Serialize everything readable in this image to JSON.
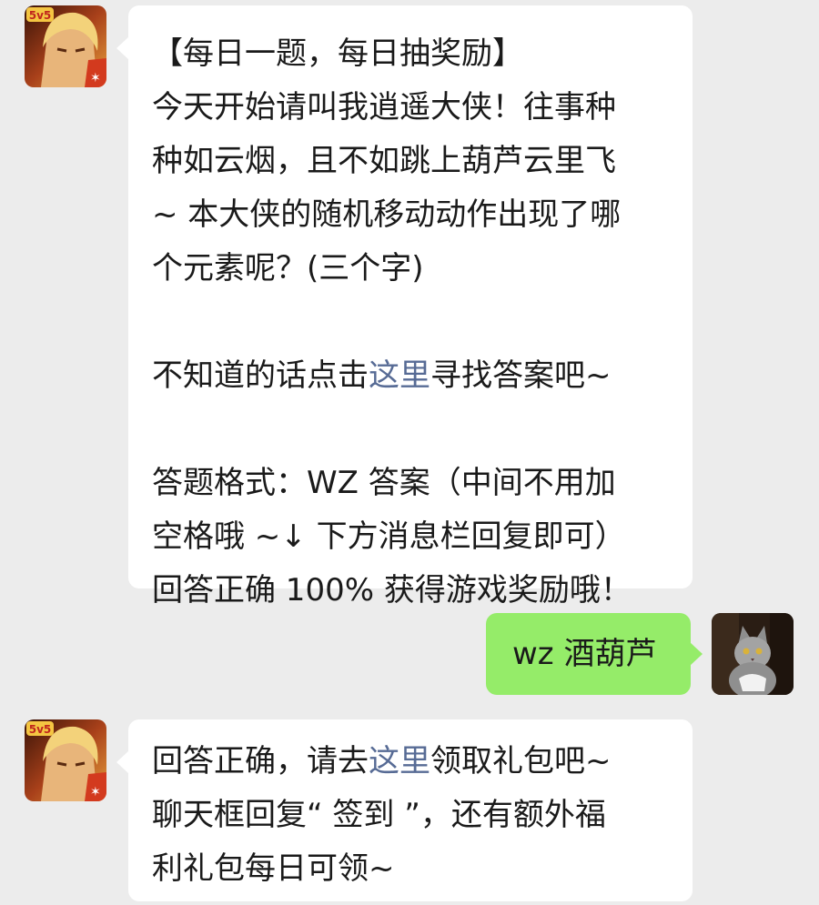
{
  "messages": {
    "question": {
      "lines": [
        "【每日一题，每日抽奖励】",
        "今天开始请叫我逍遥大侠！往事种",
        "种如云烟，且不如跳上葫芦云里飞",
        "~ 本大侠的随机移动动作出现了哪",
        "个元素呢？(三个字)"
      ],
      "hint_before": "不知道的话点击",
      "hint_link": "这里",
      "hint_after": "寻找答案吧~",
      "format_lines": [
        "答题格式：WZ 答案（中间不用加",
        "空格哦 ~↓ 下方消息栏回复即可）",
        "回答正确 100% 获得游戏奖励哦！"
      ]
    },
    "reply": {
      "text": "wz 酒葫芦"
    },
    "answer": {
      "line1_before": "回答正确，请去",
      "line1_link": "这里",
      "line1_after": "领取礼包吧~",
      "lines": [
        "聊天框回复“ 签到 ”，还有额外福",
        "利礼包每日可领~"
      ]
    }
  },
  "avatars": {
    "game_badge": "5v5"
  },
  "colors": {
    "background": "#ececec",
    "incoming_bubble": "#ffffff",
    "outgoing_bubble": "#95ec69",
    "link": "#576b95"
  }
}
